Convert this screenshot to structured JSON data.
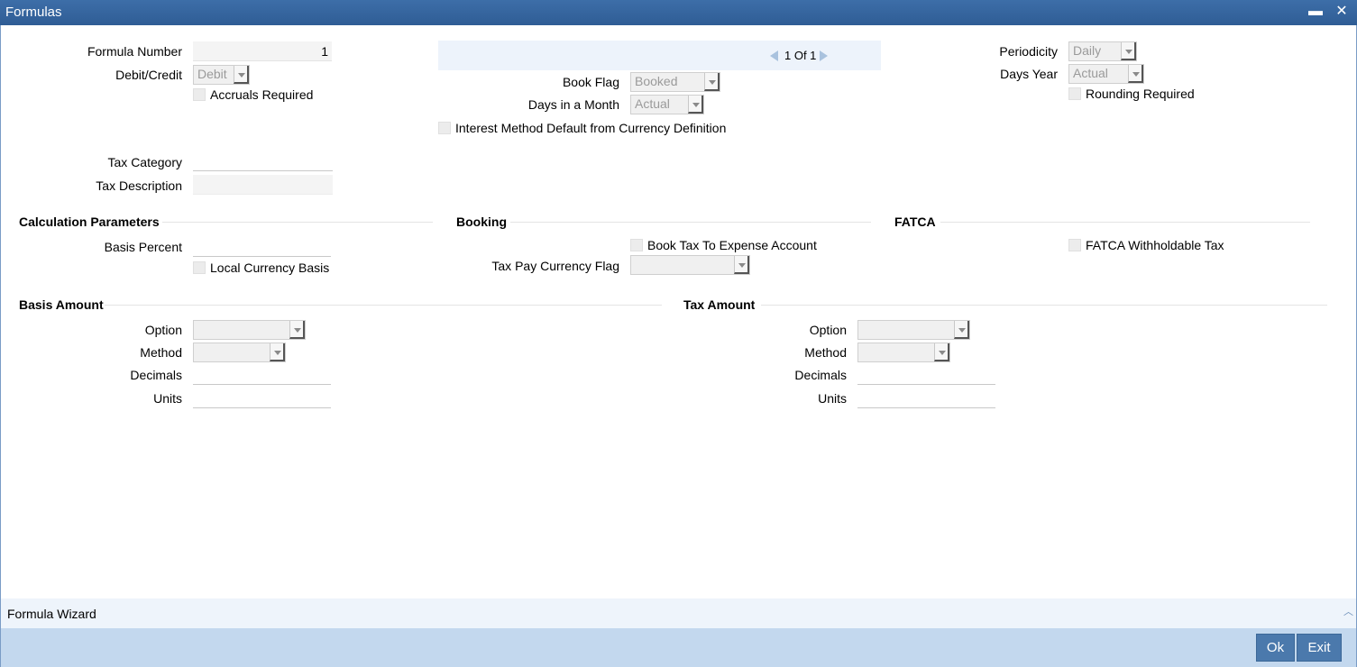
{
  "window": {
    "title": "Formulas",
    "minimize_glyph": "▬",
    "close_glyph": "✕"
  },
  "header": {
    "formula_number_label": "Formula Number",
    "formula_number_value": "1",
    "debit_credit_label": "Debit/Credit",
    "debit_credit_value": "Debit",
    "accruals_required_label": "Accruals Required"
  },
  "pager": {
    "text": "1 Of 1"
  },
  "booking_flags": {
    "book_flag_label": "Book Flag",
    "book_flag_value": "Booked",
    "days_in_month_label": "Days in a Month",
    "days_in_month_value": "Actual",
    "interest_method_label": "Interest Method Default from Currency Definition"
  },
  "periodicity": {
    "periodicity_label": "Periodicity",
    "periodicity_value": "Daily",
    "days_year_label": "Days Year",
    "days_year_value": "Actual",
    "rounding_required_label": "Rounding Required"
  },
  "tax": {
    "tax_category_label": "Tax Category",
    "tax_category_value": "",
    "tax_description_label": "Tax Description",
    "tax_description_value": ""
  },
  "calculation_parameters": {
    "title": "Calculation Parameters",
    "basis_percent_label": "Basis Percent",
    "local_currency_basis_label": "Local Currency Basis"
  },
  "booking": {
    "title": "Booking",
    "book_tax_expense_label": "Book Tax To Expense Account",
    "tax_pay_currency_label": "Tax Pay Currency Flag",
    "tax_pay_currency_value": ""
  },
  "fatca": {
    "title": "FATCA",
    "withholdable_label": "FATCA Withholdable Tax"
  },
  "basis_amount": {
    "title": "Basis Amount",
    "option_label": "Option",
    "option_value": "",
    "method_label": "Method",
    "method_value": "",
    "decimals_label": "Decimals",
    "units_label": "Units"
  },
  "tax_amount": {
    "title": "Tax Amount",
    "option_label": "Option",
    "option_value": "",
    "method_label": "Method",
    "method_value": "",
    "decimals_label": "Decimals",
    "units_label": "Units"
  },
  "footer": {
    "wizard_label": "Formula Wizard",
    "ok_label": "Ok",
    "exit_label": "Exit"
  }
}
